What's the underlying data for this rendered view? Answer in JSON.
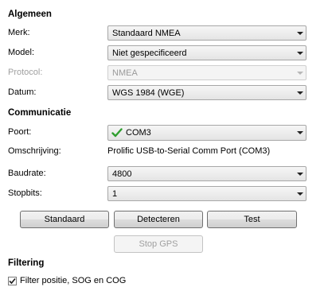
{
  "algemeen": {
    "title": "Algemeen",
    "merk": {
      "label": "Merk:",
      "value": "Standaard NMEA"
    },
    "model": {
      "label": "Model:",
      "value": "Niet gespecificeerd"
    },
    "protocol": {
      "label": "Protocol:",
      "value": "NMEA"
    },
    "datum": {
      "label": "Datum:",
      "value": "WGS 1984 (WGE)"
    }
  },
  "communicatie": {
    "title": "Communicatie",
    "poort": {
      "label": "Poort:",
      "value": "COM3",
      "icon": "check-icon",
      "icon_color": "#2e9e2e"
    },
    "omschrijving": {
      "label": "Omschrijving:",
      "value": "Prolific USB-to-Serial Comm Port (COM3)"
    },
    "baudrate": {
      "label": "Baudrate:",
      "value": "4800"
    },
    "stopbits": {
      "label": "Stopbits:",
      "value": "1"
    }
  },
  "buttons": {
    "standaard": "Standaard",
    "detecteren": "Detecteren",
    "test": "Test",
    "stop_gps": "Stop GPS"
  },
  "filtering": {
    "title": "Filtering",
    "checkbox_label": "Filter positie, SOG en COG",
    "checked": true
  }
}
